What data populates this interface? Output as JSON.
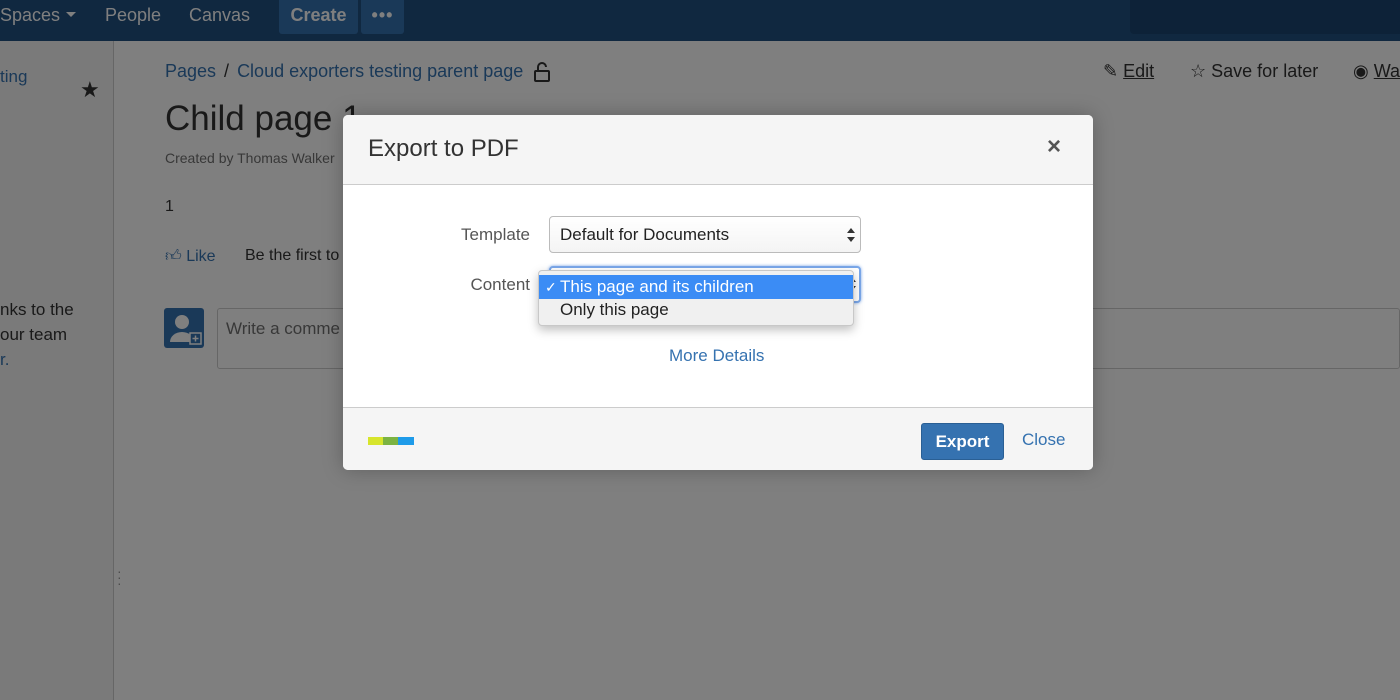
{
  "topnav": {
    "spaces": "Spaces",
    "people": "People",
    "canvas": "Canvas",
    "create": "Create",
    "more": "•••",
    "brand_color": "#205081"
  },
  "sidebar": {
    "link_fragment": "ting",
    "text_lines": [
      "nks to the",
      "our team"
    ],
    "link_fragment_2": "r."
  },
  "breadcrumb": {
    "items": [
      "Pages",
      "Cloud exporters testing parent page"
    ],
    "separator": "/"
  },
  "page_actions": {
    "edit": "Edit",
    "save_for_later": "Save for later",
    "watch": "Wa"
  },
  "page": {
    "title": "Child page 1",
    "meta": "Created by Thomas Walker",
    "body": "1",
    "like": "Like",
    "like_first": "Be the first to",
    "comment_placeholder": "Write a comme"
  },
  "dialog": {
    "title": "Export to PDF",
    "close_x": "×",
    "template_label": "Template",
    "template_value": "Default for Documents",
    "content_label": "Content",
    "content_options": [
      {
        "label": "This page and its children",
        "selected": true
      },
      {
        "label": "Only this page",
        "selected": false
      }
    ],
    "check_mark": "✓",
    "more_details": "More Details",
    "export_button": "Export",
    "close_button": "Close",
    "accent_color": "#3572b0",
    "selected_option_color": "#3b8cf5"
  }
}
